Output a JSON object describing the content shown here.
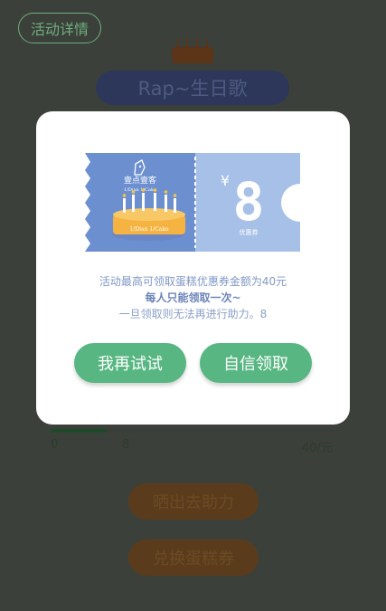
{
  "page": {
    "detail_button": "活动详情",
    "song_title": "Rap~生日歌",
    "progress": {
      "fraction": 0.2,
      "min_label": "0",
      "current_label": "8",
      "max_label": "40/元"
    },
    "buttons": {
      "share": "晒出去助力",
      "redeem": "兑换蛋糕券"
    }
  },
  "modal": {
    "coupon": {
      "brand_cn": "壹点壹客",
      "brand_en": "1/Dian 1/Cake",
      "cake_label": "1/Dian 1/Cake",
      "currency": "¥",
      "amount": "8",
      "type": "优惠券"
    },
    "message_line1": "活动最高可领取蛋糕优惠券金额为40元",
    "message_line2": "每人只能领取一次~",
    "message_line3": "一旦领取则无法再进行助力。8",
    "try_again": "我再试试",
    "claim": "自信领取"
  },
  "colors": {
    "overlay_bg": "#3b403a",
    "modal_bg": "#ffffff",
    "coupon_left": "#6c8fd0",
    "coupon_right": "#a7c0e8",
    "action_green": "#57b682"
  }
}
